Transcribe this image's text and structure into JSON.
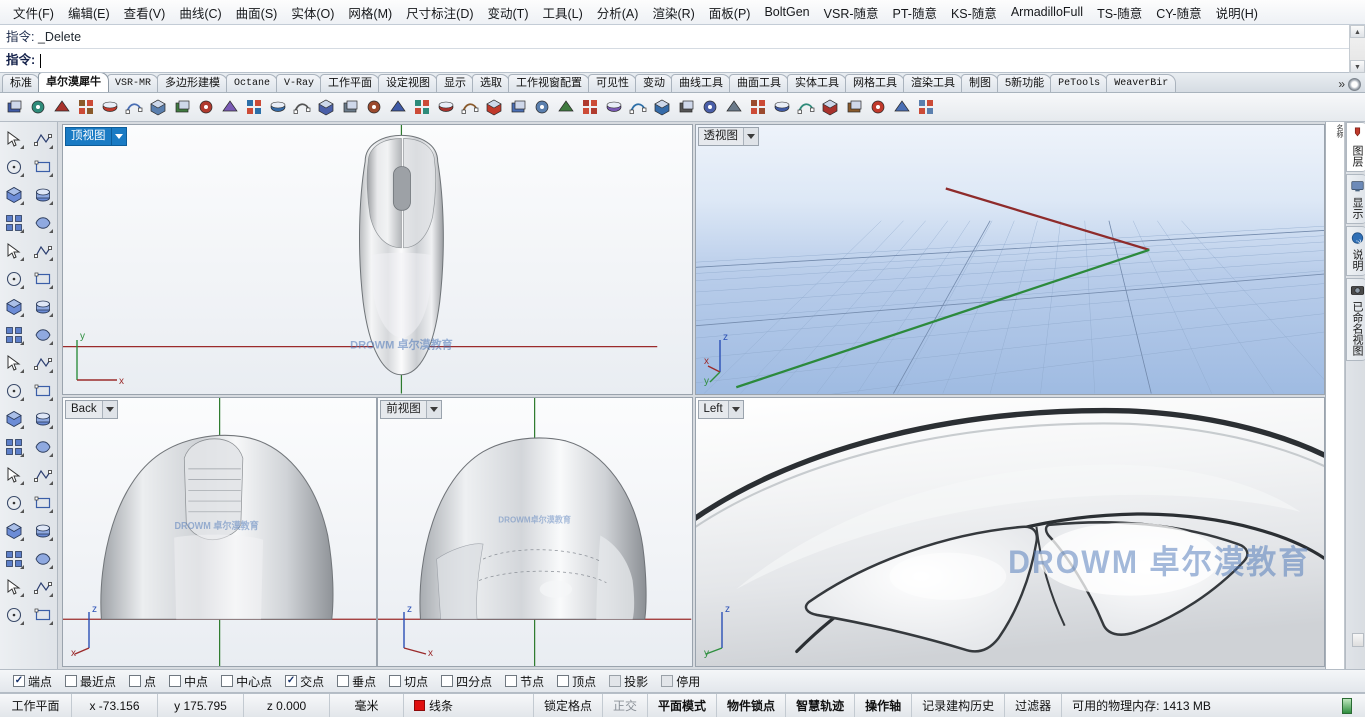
{
  "menubar": {
    "items": [
      {
        "label": "文件(F)"
      },
      {
        "label": "编辑(E)"
      },
      {
        "label": "查看(V)"
      },
      {
        "label": "曲线(C)"
      },
      {
        "label": "曲面(S)"
      },
      {
        "label": "实体(O)"
      },
      {
        "label": "网格(M)"
      },
      {
        "label": "尺寸标注(D)"
      },
      {
        "label": "变动(T)"
      },
      {
        "label": "工具(L)"
      },
      {
        "label": "分析(A)"
      },
      {
        "label": "渲染(R)"
      },
      {
        "label": "面板(P)"
      },
      {
        "label": "BoltGen"
      },
      {
        "label": "VSR-随意"
      },
      {
        "label": "PT-随意"
      },
      {
        "label": "KS-随意"
      },
      {
        "label": "ArmadilloFull"
      },
      {
        "label": "TS-随意"
      },
      {
        "label": "CY-随意"
      },
      {
        "label": "说明(H)"
      }
    ]
  },
  "command": {
    "history_label": "指令:",
    "history_value": "_Delete",
    "prompt_label": "指令:",
    "input_value": "",
    "scroll_up": "▲",
    "scroll_down": "▼"
  },
  "tabstrip": {
    "tabs": [
      {
        "label": "标准",
        "active": false,
        "mono": false
      },
      {
        "label": "卓尔漠犀牛",
        "active": true,
        "mono": false
      },
      {
        "label": "VSR-MR",
        "active": false,
        "mono": true
      },
      {
        "label": "多边形建模",
        "active": false,
        "mono": false
      },
      {
        "label": "Octane",
        "active": false,
        "mono": true
      },
      {
        "label": "V-Ray",
        "active": false,
        "mono": true
      },
      {
        "label": "工作平面",
        "active": false,
        "mono": false
      },
      {
        "label": "设定视图",
        "active": false,
        "mono": false
      },
      {
        "label": "显示",
        "active": false,
        "mono": false
      },
      {
        "label": "选取",
        "active": false,
        "mono": false
      },
      {
        "label": "工作视窗配置",
        "active": false,
        "mono": false
      },
      {
        "label": "可见性",
        "active": false,
        "mono": false
      },
      {
        "label": "变动",
        "active": false,
        "mono": false
      },
      {
        "label": "曲线工具",
        "active": false,
        "mono": false
      },
      {
        "label": "曲面工具",
        "active": false,
        "mono": false
      },
      {
        "label": "实体工具",
        "active": false,
        "mono": false
      },
      {
        "label": "网格工具",
        "active": false,
        "mono": false
      },
      {
        "label": "渲染工具",
        "active": false,
        "mono": false
      },
      {
        "label": "制图",
        "active": false,
        "mono": false
      },
      {
        "label": "5新功能",
        "active": false,
        "mono": false
      },
      {
        "label": "PeTools",
        "active": false,
        "mono": true
      },
      {
        "label": "WeaverBir",
        "active": false,
        "mono": true
      }
    ],
    "overflow_label": "»"
  },
  "toolbar": {
    "icons": [
      {
        "name": "fillet-curve-icon"
      },
      {
        "name": "box-edit-icon"
      },
      {
        "name": "extrude-icon"
      },
      {
        "name": "sphere-texture-icon"
      },
      {
        "name": "checker-surface-icon"
      },
      {
        "name": "link-icon"
      },
      {
        "name": "revolve-icon"
      },
      {
        "name": "render-preview-icon"
      },
      {
        "name": "curvature-graph-icon"
      },
      {
        "name": "rainbow-zebra-icon"
      },
      {
        "name": "draft-angle-icon"
      },
      {
        "name": "point-deviation-icon"
      },
      {
        "name": "checker-pattern-icon"
      },
      {
        "name": "polysurface-icon"
      },
      {
        "name": "rectangle-pt-icon"
      },
      {
        "name": "circle-target-icon"
      },
      {
        "name": "plane-point-icon"
      },
      {
        "name": "sphere-pt-icon"
      },
      {
        "name": "control-points-icon"
      },
      {
        "name": "cylinder-icon"
      },
      {
        "name": "diamond-icon"
      },
      {
        "name": "point-cloud-icon"
      },
      {
        "name": "grid-array-icon"
      },
      {
        "name": "shade-icon"
      },
      {
        "name": "cube-texture-icon"
      },
      {
        "name": "cube-unwrap-icon"
      },
      {
        "name": "face-icon"
      },
      {
        "name": "move-axis-icon"
      },
      {
        "name": "color-grid-icon"
      },
      {
        "name": "mesh-surface-icon"
      },
      {
        "name": "curve-points-icon"
      },
      {
        "name": "cube-mesh-icon"
      },
      {
        "name": "points-small-icon"
      },
      {
        "name": "offset-surface-icon"
      },
      {
        "name": "mesh-split-icon"
      },
      {
        "name": "drop-cube-icon"
      },
      {
        "name": "mesh-drape-icon"
      },
      {
        "name": "curve-handle-icon"
      },
      {
        "name": "blend-icon"
      }
    ]
  },
  "left_toolbar": {
    "rows": [
      [
        {
          "name": "select-arrow-icon"
        },
        {
          "name": "point-icon"
        }
      ],
      [
        {
          "name": "polyline-icon"
        },
        {
          "name": "control-point-curve-icon"
        }
      ],
      [
        {
          "name": "circle-icon"
        },
        {
          "name": "ellipse-icon"
        }
      ],
      [
        {
          "name": "arc-icon"
        },
        {
          "name": "rectangle-icon"
        }
      ],
      [
        {
          "name": "polygon-icon"
        },
        {
          "name": "free-curve-icon"
        }
      ],
      [
        {
          "name": "surface-points-icon"
        },
        {
          "name": "sweep-surface-icon"
        }
      ],
      [
        {
          "name": "box-solid-icon"
        },
        {
          "name": "sphere-solid-icon"
        }
      ],
      [
        {
          "name": "cylinder-solid-icon"
        },
        {
          "name": "mesh-plane-icon"
        }
      ],
      [
        {
          "name": "boolean-union-icon"
        },
        {
          "name": "explode-icon"
        }
      ],
      [
        {
          "name": "trim-icon"
        },
        {
          "name": "split-icon"
        }
      ],
      [
        {
          "name": "boolean-icon"
        },
        {
          "name": "curve-boolean-icon"
        }
      ],
      [
        {
          "name": "fillet-icon"
        },
        {
          "name": "offset-curve-icon"
        }
      ],
      [
        {
          "name": "text-icon"
        },
        {
          "name": "scale-icon"
        }
      ],
      [
        {
          "name": "copy-icon"
        },
        {
          "name": "rotate-icon"
        }
      ],
      [
        {
          "name": "cap-solid-icon"
        },
        {
          "name": "extrude-plane-icon"
        }
      ],
      [
        {
          "name": "array-grid-icon"
        },
        {
          "name": "array-linear-icon"
        }
      ],
      [
        {
          "name": "mirror-icon"
        },
        {
          "name": "check-icon"
        }
      ],
      [
        {
          "name": "shade-object-icon"
        },
        {
          "name": "more-chevron-icon"
        }
      ]
    ]
  },
  "viewports": [
    {
      "id": "top",
      "label": "顶视图",
      "selected": true,
      "axes": {
        "a": "y",
        "b": "x"
      },
      "watermark": "DROWM 卓尔漠教育"
    },
    {
      "id": "perspective",
      "label": "透视图",
      "selected": false,
      "axes": {
        "a": "z",
        "b": "x",
        "c": "y"
      },
      "watermark": ""
    },
    {
      "id": "back",
      "label": "Back",
      "selected": false,
      "axes": {
        "a": "z",
        "b": "x"
      },
      "watermark": "DROWM 卓尔漠教育"
    },
    {
      "id": "front",
      "label": "前视图",
      "selected": false,
      "axes": {
        "a": "z",
        "b": "x"
      },
      "watermark": "DROWM卓尔漠教育"
    },
    {
      "id": "left",
      "label": "Left",
      "selected": false,
      "axes": {
        "a": "z",
        "b": "y"
      },
      "watermark": "DROWM 卓尔漠教育"
    }
  ],
  "right_panel": {
    "tabs": [
      {
        "label": "图层",
        "icon": "layers-icon",
        "active": true
      },
      {
        "label": "显示",
        "icon": "monitor-icon",
        "active": false
      },
      {
        "label": "说明",
        "icon": "help-icon",
        "active": false
      },
      {
        "label": "已命名视图",
        "icon": "camera-icon",
        "active": false
      }
    ],
    "list_header": "名称"
  },
  "osnap": {
    "items": [
      {
        "label": "端点",
        "checked": true,
        "style": "normal"
      },
      {
        "label": "最近点",
        "checked": false,
        "style": "normal"
      },
      {
        "label": "点",
        "checked": false,
        "style": "normal"
      },
      {
        "label": "中点",
        "checked": false,
        "style": "normal"
      },
      {
        "label": "中心点",
        "checked": false,
        "style": "normal"
      },
      {
        "label": "交点",
        "checked": true,
        "style": "normal"
      },
      {
        "label": "垂点",
        "checked": false,
        "style": "normal"
      },
      {
        "label": "切点",
        "checked": false,
        "style": "normal"
      },
      {
        "label": "四分点",
        "checked": false,
        "style": "normal"
      },
      {
        "label": "节点",
        "checked": false,
        "style": "normal"
      },
      {
        "label": "顶点",
        "checked": false,
        "style": "normal"
      },
      {
        "label": "投影",
        "checked": false,
        "style": "grey"
      },
      {
        "label": "停用",
        "checked": false,
        "style": "grey"
      }
    ]
  },
  "statusbar": {
    "cplane": "工作平面",
    "x": "x -73.156",
    "y": "y 175.795",
    "z": "z 0.000",
    "units": "毫米",
    "layer": "线条",
    "layer_color": "#e01010",
    "toggles": [
      {
        "label": "锁定格点",
        "bold": false,
        "dim": false
      },
      {
        "label": "正交",
        "bold": false,
        "dim": true
      },
      {
        "label": "平面模式",
        "bold": true,
        "dim": false
      },
      {
        "label": "物件锁点",
        "bold": true,
        "dim": false
      },
      {
        "label": "智慧轨迹",
        "bold": true,
        "dim": false
      },
      {
        "label": "操作轴",
        "bold": true,
        "dim": false
      },
      {
        "label": "记录建构历史",
        "bold": false,
        "dim": false
      },
      {
        "label": "过滤器",
        "bold": false,
        "dim": false
      }
    ],
    "memory": "可用的物理内存: 1413 MB"
  }
}
